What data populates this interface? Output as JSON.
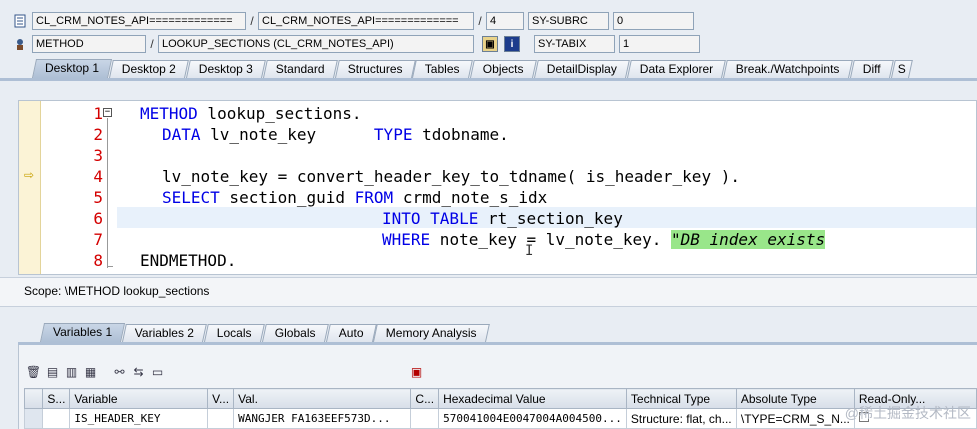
{
  "info": {
    "row1": {
      "class_field": "CL_CRM_NOTES_API=============",
      "class_field2": "CL_CRM_NOTES_API=============",
      "num": "4",
      "sy_label": "SY-SUBRC",
      "sy_value": "0"
    },
    "row2": {
      "type_field": "METHOD",
      "method_field": "LOOKUP_SECTIONS (CL_CRM_NOTES_API)",
      "sy_label": "SY-TABIX",
      "sy_value": "1"
    }
  },
  "top_tabs": [
    "Desktop 1",
    "Desktop 2",
    "Desktop 3",
    "Standard",
    "Structures",
    "Tables",
    "Objects",
    "DetailDisplay",
    "Data Explorer",
    "Break./Watchpoints",
    "Diff",
    "S"
  ],
  "code": {
    "line_numbers": [
      "1",
      "2",
      "3",
      "4",
      "5",
      "6",
      "7",
      "8"
    ],
    "l1_kw": "METHOD",
    "l1_rest": " lookup_sections.",
    "l2_kw": "DATA",
    "l2_mid": " lv_note_key      ",
    "l2_kw2": "TYPE",
    "l2_rest": " tdobname.",
    "l4": "lv_note_key = convert_header_key_to_tdname( is_header_key ).",
    "l5_kw": "SELECT",
    "l5_mid": " section_guid ",
    "l5_kw2": "FROM",
    "l5_rest": " crmd_note_s_idx",
    "l6_kw": "INTO TABLE",
    "l6_rest": " rt_section_key",
    "l7_kw": "WHERE",
    "l7_rest": " note_key = lv_note_key. ",
    "l7_comment": "\"DB index exists",
    "l8_kw": "ENDMETHOD."
  },
  "scope": "Scope: \\METHOD lookup_sections",
  "var_tabs": [
    "Variables 1",
    "Variables 2",
    "Locals",
    "Globals",
    "Auto",
    "Memory Analysis"
  ],
  "table": {
    "headers": [
      "S...",
      "Variable",
      "V...",
      "Val.",
      "C...",
      "Hexadecimal Value",
      "Technical Type",
      "Absolute Type",
      "Read-Only..."
    ],
    "row": {
      "variable": "IS_HEADER_KEY",
      "val": "WANGJER     FA163EEF573D...",
      "hex": "570041004E0047004A004500...",
      "tech": "Structure: flat, ch...",
      "abs": "\\TYPE=CRM_S_N..."
    }
  },
  "watermark": "@稀土掘金技术社区"
}
